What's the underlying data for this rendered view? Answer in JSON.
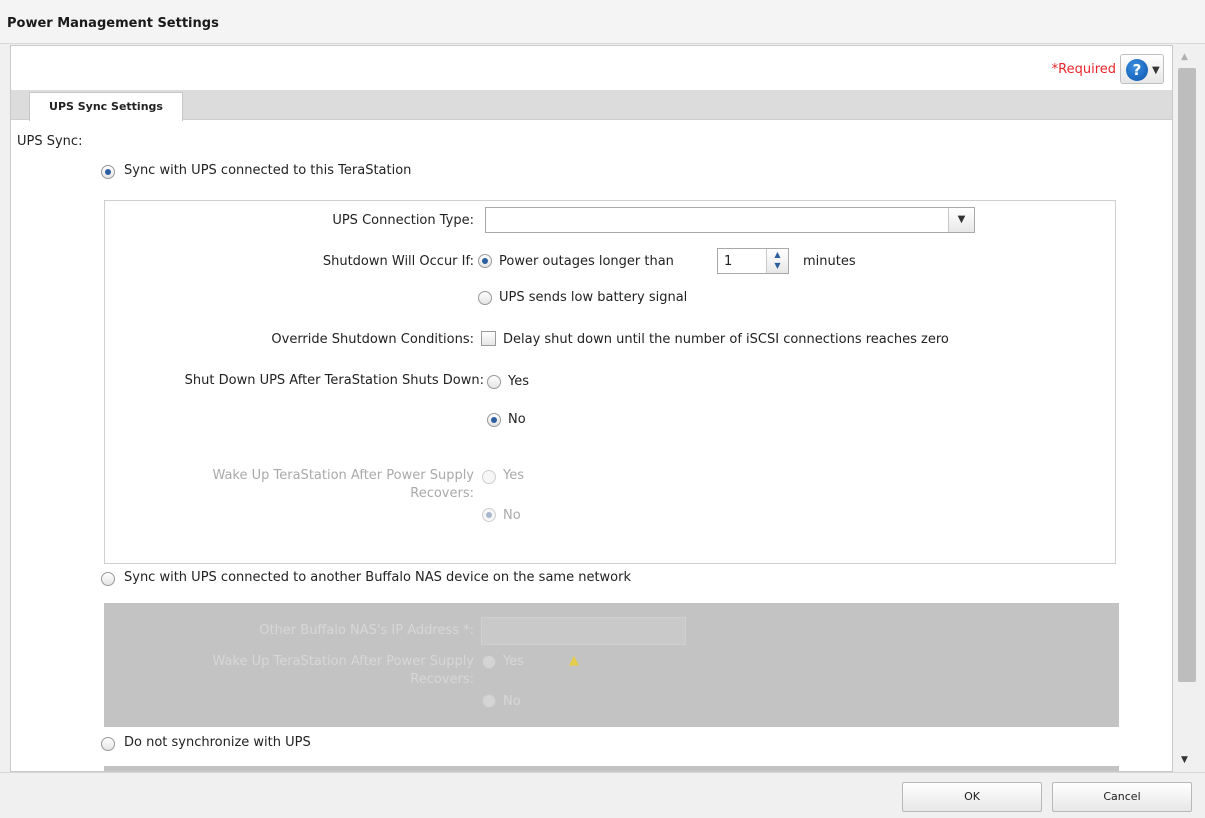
{
  "window": {
    "title": "Power Management Settings"
  },
  "header": {
    "required_label": "*Required",
    "help_icon": "question-circle-icon"
  },
  "tabs": [
    {
      "label": "UPS Sync Settings",
      "active": true
    }
  ],
  "form": {
    "section_label": "UPS Sync:",
    "option1": {
      "label": "Sync with UPS connected to this TeraStation",
      "selected": true,
      "connection_type": {
        "label": "UPS Connection Type:",
        "value": ""
      },
      "shutdown": {
        "label": "Shutdown Will Occur If:",
        "power_outage_label": "Power outages longer than",
        "minutes_value": "1",
        "minutes_unit": "minutes",
        "low_battery_label": "UPS sends low battery signal",
        "selected": "power_outage"
      },
      "override": {
        "label": "Override Shutdown Conditions:",
        "checkbox_label": "Delay shut down until the number of iSCSI connections reaches zero",
        "checked": false
      },
      "shutdown_ups": {
        "label": "Shut Down UPS After TeraStation Shuts Down:",
        "yes": "Yes",
        "no": "No",
        "selected": "no"
      },
      "wake_up": {
        "label_line1": "Wake Up TeraStation After Power Supply",
        "label_line2": "Recovers:",
        "yes": "Yes",
        "no": "No",
        "selected": "no"
      }
    },
    "option2": {
      "label": "Sync with UPS connected to another Buffalo NAS device on the same network",
      "selected": false,
      "ip_label": "Other Buffalo NAS's IP Address *:",
      "ip_value": "",
      "wake_up": {
        "label_line1": "Wake Up TeraStation After Power Supply",
        "label_line2": "Recovers:",
        "yes": "Yes",
        "no": "No"
      }
    },
    "option3": {
      "label": "Do not synchronize with UPS",
      "selected": false
    }
  },
  "footer": {
    "ok_label": "OK",
    "cancel_label": "Cancel"
  },
  "colors": {
    "required": "#e8262a",
    "help_blue": "#0a55ad",
    "disabled_panel": "#c3c3c3"
  }
}
